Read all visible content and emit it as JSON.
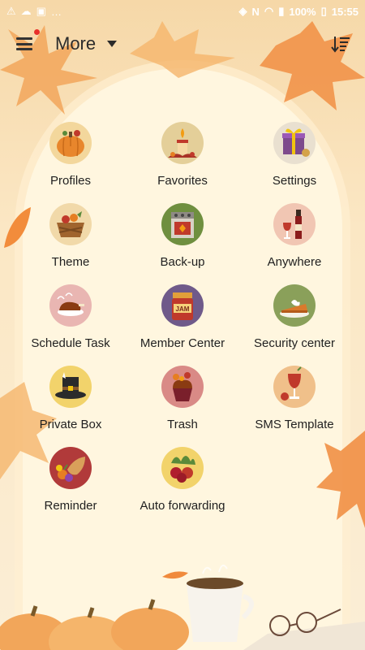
{
  "status_bar": {
    "battery_text": "100%",
    "time": "15:55",
    "left_icons": [
      "warning-icon",
      "sync-icon",
      "bag-icon",
      "more-dots-icon"
    ],
    "right_icons": [
      "nfc-icon",
      "sim-icon",
      "wifi-icon",
      "signal-icon",
      "battery-icon"
    ]
  },
  "toolbar": {
    "title": "More",
    "menu_icon": "hamburger-icon",
    "sort_icon": "sort-list-icon",
    "has_notification_dot": true
  },
  "items": [
    {
      "label": "Profiles",
      "icon": "pumpkin-icon"
    },
    {
      "label": "Favorites",
      "icon": "candle-icon"
    },
    {
      "label": "Settings",
      "icon": "gift-box-icon"
    },
    {
      "label": "Theme",
      "icon": "basket-icon"
    },
    {
      "label": "Back-up",
      "icon": "oven-icon"
    },
    {
      "label": "Anywhere",
      "icon": "wine-icon"
    },
    {
      "label": "Schedule Task",
      "icon": "roast-turkey-icon"
    },
    {
      "label": "Member Center",
      "icon": "jam-jar-icon"
    },
    {
      "label": "Security center",
      "icon": "pie-slice-icon"
    },
    {
      "label": "Private Box",
      "icon": "pilgrim-hat-icon"
    },
    {
      "label": "Trash",
      "icon": "cupcake-icon"
    },
    {
      "label": "SMS Template",
      "icon": "cocktail-icon"
    },
    {
      "label": "Reminder",
      "icon": "cornucopia-icon"
    },
    {
      "label": "Auto forwarding",
      "icon": "berries-icon"
    }
  ],
  "colors": {
    "background": "#fbeed3",
    "accent_leaf": "#f08a3c",
    "notification_dot": "#e8302a",
    "text": "#1f1f1f"
  }
}
